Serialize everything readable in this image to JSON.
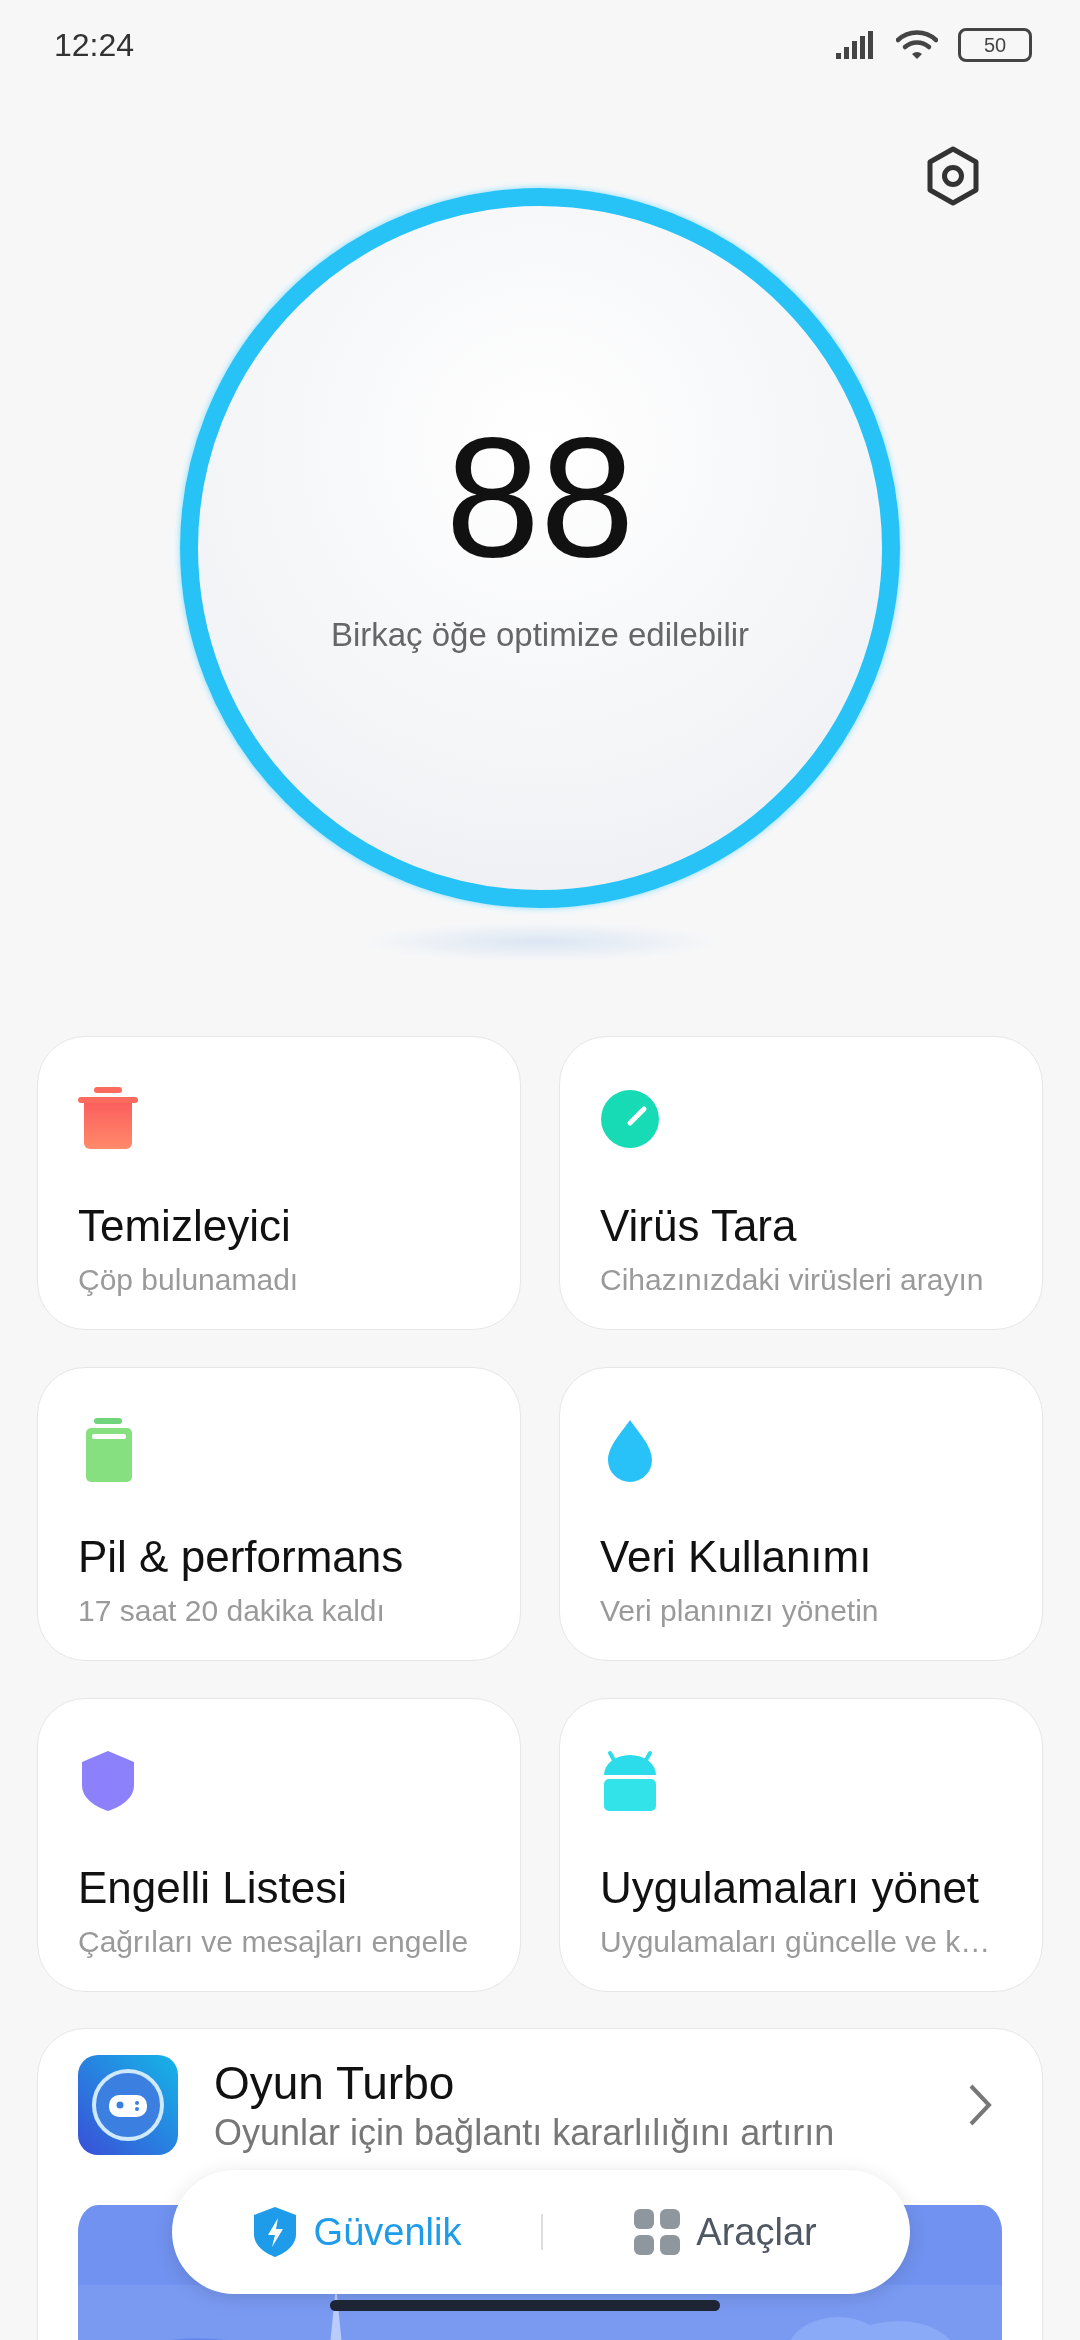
{
  "status_bar": {
    "time": "12:24",
    "battery": "50"
  },
  "score": {
    "value": "88",
    "caption": "Birkaç öğe optimize edilebilir"
  },
  "cards": [
    {
      "title": "Temizleyici",
      "subtitle": "Çöp bulunamadı"
    },
    {
      "title": "Virüs Tara",
      "subtitle": "Cihazınızdaki virüsleri arayın"
    },
    {
      "title": "Pil & performans",
      "subtitle": "17 saat 20 dakika  kaldı"
    },
    {
      "title": "Veri Kullanımı",
      "subtitle": "Veri planınızı yönetin"
    },
    {
      "title": "Engelli Listesi",
      "subtitle": "Çağrıları ve mesajları engelle"
    },
    {
      "title": "Uygulamaları yönet",
      "subtitle": "Uygulamaları güncelle ve k…"
    }
  ],
  "feature": {
    "title": "Oyun Turbo",
    "subtitle": "Oyunlar için bağlantı kararlılığını artırın"
  },
  "tabs": [
    {
      "label": "Güvenlik",
      "selected": true
    },
    {
      "label": "Araçlar",
      "selected": false
    }
  ]
}
